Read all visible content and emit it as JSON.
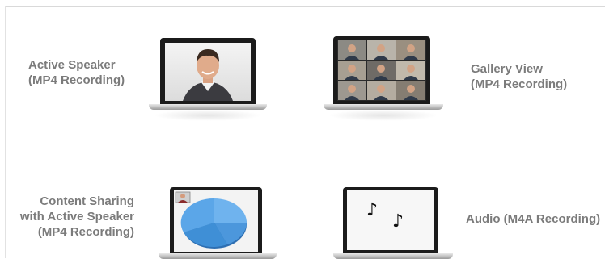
{
  "labels": {
    "active_speaker": "Active Speaker\n(MP4 Recording)",
    "gallery_view": "Gallery View\n(MP4 Recording)",
    "content_sharing": "Content Sharing\nwith Active Speaker\n(MP4 Recording)",
    "audio": "Audio (M4A Recording)"
  },
  "icons": {
    "audio_notes": [
      "♪",
      "♪"
    ]
  },
  "colors": {
    "label_text": "#7b7b7b",
    "pie_blue": "#3f8fd6"
  }
}
